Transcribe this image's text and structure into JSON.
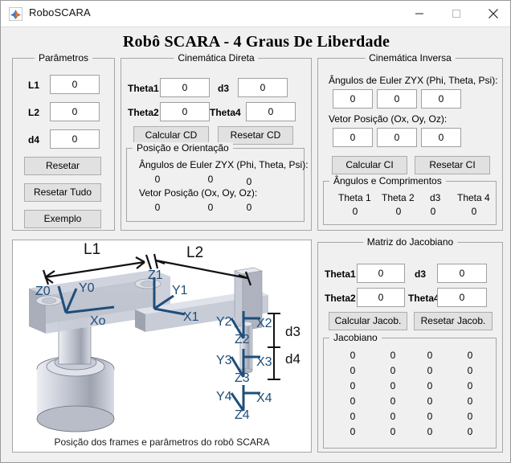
{
  "window": {
    "title": "RoboSCARA",
    "icon": "matlab-icon",
    "minimize": "minimize-icon",
    "maximize": "maximize-icon",
    "close": "close-icon"
  },
  "heading": "Robô SCARA - 4 Graus De Liberdade",
  "parametros": {
    "title": "Parâmetros",
    "rows": [
      {
        "label": "L1",
        "value": "0"
      },
      {
        "label": "L2",
        "value": "0"
      },
      {
        "label": "d4",
        "value": "0"
      }
    ],
    "buttons": [
      {
        "label": "Resetar"
      },
      {
        "label": "Resetar Tudo"
      },
      {
        "label": "Exemplo"
      }
    ]
  },
  "cinematica_direta": {
    "title": "Cinemática Direta",
    "inputs": [
      {
        "label": "Theta1",
        "value": "0"
      },
      {
        "label": "d3",
        "value": "0"
      },
      {
        "label": "Theta2",
        "value": "0"
      },
      {
        "label": "Theta4",
        "value": "0"
      }
    ],
    "calcular": "Calcular CD",
    "resetar": "Resetar CD",
    "posicao_orientacao": {
      "title": "Posição e Orientação",
      "euler_label": "Ângulos de Euler ZYX (Phi, Theta, Psi):",
      "euler_values": [
        "0",
        "0",
        "0"
      ],
      "posicao_label": "Vetor Posição (Ox, Oy, Oz):",
      "posicao_values": [
        "0",
        "0",
        "0"
      ]
    }
  },
  "cinematica_inversa": {
    "title": "Cinemática Inversa",
    "euler_label": "Ângulos de Euler ZYX (Phi, Theta, Psi):",
    "euler_values": [
      "0",
      "0",
      "0"
    ],
    "posicao_label": "Vetor Posição (Ox, Oy, Oz):",
    "posicao_values": [
      "0",
      "0",
      "0"
    ],
    "calcular": "Calcular CI",
    "resetar": "Resetar CI",
    "angulos_comprimentos": {
      "title": "Ângulos e Comprimentos",
      "headers": [
        "Theta 1",
        "Theta 2",
        "d3",
        "Theta 4"
      ],
      "values": [
        "0",
        "0",
        "0",
        "0"
      ]
    }
  },
  "jacobiano_panel": {
    "title": "Matriz do Jacobiano",
    "inputs": [
      {
        "label": "Theta1",
        "value": "0"
      },
      {
        "label": "d3",
        "value": "0"
      },
      {
        "label": "Theta2",
        "value": "0"
      },
      {
        "label": "Theta4",
        "value": "0"
      }
    ],
    "calcular": "Calcular Jacob.",
    "resetar": "Resetar Jacob.",
    "matrix": {
      "title": "Jacobiano",
      "rows": [
        [
          "0",
          "0",
          "0",
          "0"
        ],
        [
          "0",
          "0",
          "0",
          "0"
        ],
        [
          "0",
          "0",
          "0",
          "0"
        ],
        [
          "0",
          "0",
          "0",
          "0"
        ],
        [
          "0",
          "0",
          "0",
          "0"
        ],
        [
          "0",
          "0",
          "0",
          "0"
        ]
      ]
    }
  },
  "diagram": {
    "caption": "Posição dos frames e parâmetros do robô SCARA",
    "dimension_labels": [
      "L1",
      "L2",
      "d3",
      "d4"
    ],
    "frame_labels": [
      "Z0",
      "Y0",
      "Xo",
      "Z1",
      "Y1",
      "X1",
      "Z2",
      "Y2",
      "X2",
      "Z3",
      "Y3",
      "X3",
      "Z4",
      "Y4",
      "X4"
    ],
    "axis_color": "#1f4e79"
  }
}
